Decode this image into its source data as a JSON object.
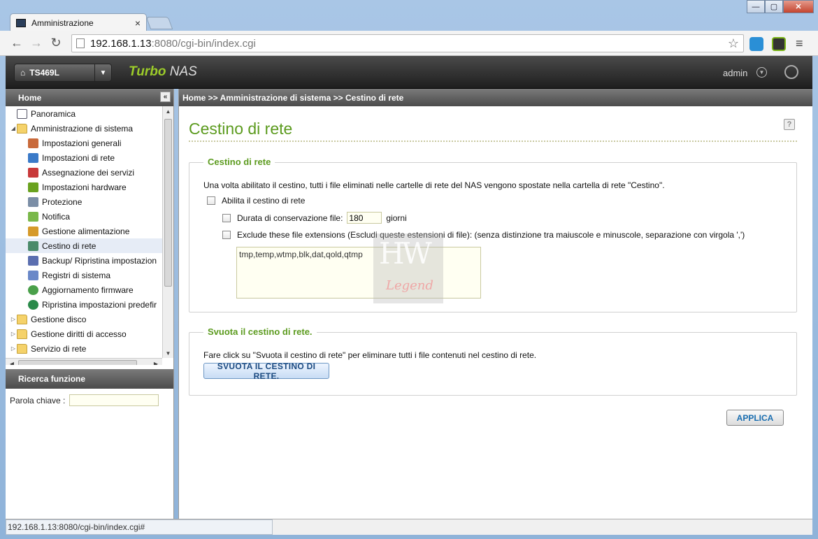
{
  "browser": {
    "tab_title": "Amministrazione",
    "tab_close": "×",
    "url_host": "192.168.1.13",
    "url_rest": ":8080/cgi-bin/index.cgi",
    "status_url": "192.168.1.13:8080/cgi-bin/index.cgi#",
    "win_min": "—",
    "win_max": "▢",
    "win_close": "✕"
  },
  "nas": {
    "model": "TS469L",
    "brand_part1": "Turbo",
    "brand_part2": " NAS",
    "user": "admin"
  },
  "sidebar": {
    "title": "Home",
    "items": [
      {
        "label": "Panoramica",
        "icon": "overview-icon"
      },
      {
        "label": "Amministrazione di sistema",
        "icon": "folder-open-icon"
      },
      {
        "label": "Impostazioni generali",
        "icon": "general-settings-icon"
      },
      {
        "label": "Impostazioni di rete",
        "icon": "network-icon"
      },
      {
        "label": "Assegnazione dei servizi",
        "icon": "services-icon"
      },
      {
        "label": "Impostazioni hardware",
        "icon": "hardware-icon"
      },
      {
        "label": "Protezione",
        "icon": "security-icon"
      },
      {
        "label": "Notifica",
        "icon": "notification-icon"
      },
      {
        "label": "Gestione alimentazione",
        "icon": "power-icon"
      },
      {
        "label": "Cestino di rete",
        "icon": "recycle-bin-icon"
      },
      {
        "label": "Backup/ Ripristina impostazion",
        "icon": "backup-icon"
      },
      {
        "label": "Registri di sistema",
        "icon": "logs-icon"
      },
      {
        "label": "Aggiornamento firmware",
        "icon": "firmware-icon"
      },
      {
        "label": "Ripristina impostazioni predefir",
        "icon": "restore-icon"
      },
      {
        "label": "Gestione disco",
        "icon": "folder-icon"
      },
      {
        "label": "Gestione diritti di accesso",
        "icon": "folder-icon"
      },
      {
        "label": "Servizio di rete",
        "icon": "folder-icon"
      }
    ],
    "search_title": "Ricerca funzione",
    "keyword_label": "Parola chiave :",
    "keyword_value": ""
  },
  "main": {
    "breadcrumb": "Home >> Amministrazione di sistema >> Cestino di rete",
    "page_title": "Cestino di rete",
    "section1": {
      "legend": "Cestino di rete",
      "description": "Una volta abilitato il cestino, tutti i file eliminati nelle cartelle di rete del NAS vengono spostate nella cartella di rete \"Cestino\".",
      "enable_label": "Abilita il cestino di rete",
      "retention_label": "Durata di conservazione file:",
      "retention_value": "180",
      "retention_unit": "giorni",
      "exclude_label": "Exclude these file extensions (Escludi queste estensioni di file):  (senza distinzione tra maiuscole e minuscole, separazione con virgola ',')",
      "extensions": "tmp,temp,wtmp,blk,dat,qold,qtmp"
    },
    "section2": {
      "legend": "Svuota il cestino di rete.",
      "description": "Fare click su \"Svuota il cestino di rete\" per eliminare tutti i file contenuti nel cestino di rete.",
      "button": "SVUOTA IL CESTINO DI RETE."
    },
    "apply_button": "APPLICA"
  }
}
